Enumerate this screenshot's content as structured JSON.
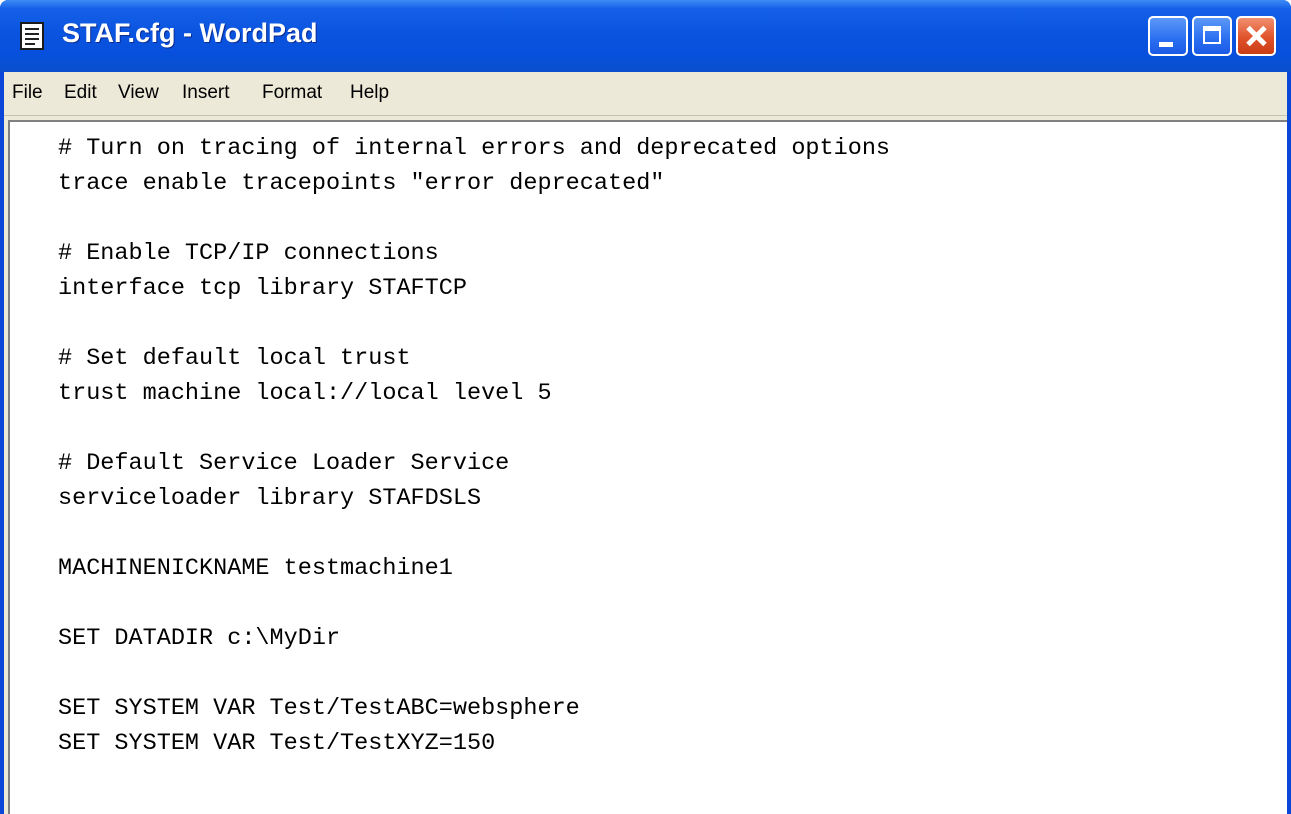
{
  "window": {
    "title": "STAF.cfg - WordPad",
    "icon": "wordpad-document-icon"
  },
  "caption_buttons": {
    "minimize": "minimize-icon",
    "maximize": "maximize-icon",
    "close": "close-icon"
  },
  "menu": {
    "items": [
      {
        "label": "File"
      },
      {
        "label": "Edit"
      },
      {
        "label": "View"
      },
      {
        "label": "Insert"
      },
      {
        "label": "Format"
      },
      {
        "label": "Help"
      }
    ]
  },
  "document": {
    "lines": [
      "# Turn on tracing of internal errors and deprecated options",
      "trace enable tracepoints \"error deprecated\"",
      "",
      "# Enable TCP/IP connections",
      "interface tcp library STAFTCP",
      "",
      "# Set default local trust",
      "trust machine local://local level 5",
      "",
      "# Default Service Loader Service",
      "serviceloader library STAFDSLS",
      "",
      "MACHINENICKNAME testmachine1",
      "",
      "SET DATADIR c:\\MyDir",
      "",
      "SET SYSTEM VAR Test/TestABC=websphere",
      "SET SYSTEM VAR Test/TestXYZ=150"
    ]
  },
  "colors": {
    "titlebar": "#0a54e0",
    "menubar": "#ece9d8",
    "close_button": "#e0522a",
    "document_background": "#ffffff"
  }
}
